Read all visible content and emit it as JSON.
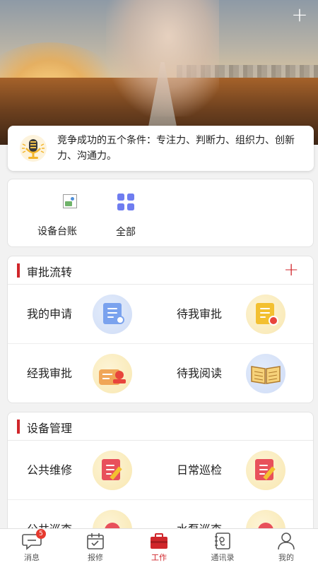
{
  "banner": {
    "add_icon": "plus-icon"
  },
  "notice": {
    "icon": "microphone-icon",
    "text": "竞争成功的五个条件：专注力、判断力、组织力、创新力、沟通力。"
  },
  "quick_entries": [
    {
      "label": "设备台账",
      "icon": "broken-image-icon"
    },
    {
      "label": "全部",
      "icon": "grid-icon"
    }
  ],
  "approval": {
    "title": "审批流转",
    "add_icon": "plus-icon",
    "items": [
      {
        "label": "我的申请",
        "icon": "application-doc-icon"
      },
      {
        "label": "待我审批",
        "icon": "pending-approval-icon"
      },
      {
        "label": "经我审批",
        "icon": "approved-stamp-icon"
      },
      {
        "label": "待我阅读",
        "icon": "open-book-icon"
      }
    ]
  },
  "equipment": {
    "title": "设备管理",
    "items": [
      {
        "label": "公共维修",
        "icon": "repair-edit-icon"
      },
      {
        "label": "日常巡检",
        "icon": "inspection-edit-icon"
      },
      {
        "label": "公共巡查",
        "icon": "patrol-icon"
      },
      {
        "label": "水泵巡查",
        "icon": "pump-patrol-icon"
      }
    ]
  },
  "nav": {
    "tabs": [
      {
        "label": "消息",
        "icon": "message-icon",
        "badge": "5"
      },
      {
        "label": "报修",
        "icon": "calendar-check-icon"
      },
      {
        "label": "工作",
        "icon": "briefcase-icon",
        "active": true
      },
      {
        "label": "通讯录",
        "icon": "contacts-icon"
      },
      {
        "label": "我的",
        "icon": "user-icon"
      }
    ]
  },
  "colors": {
    "accent": "#d0262b",
    "badge": "#e63a2f"
  }
}
